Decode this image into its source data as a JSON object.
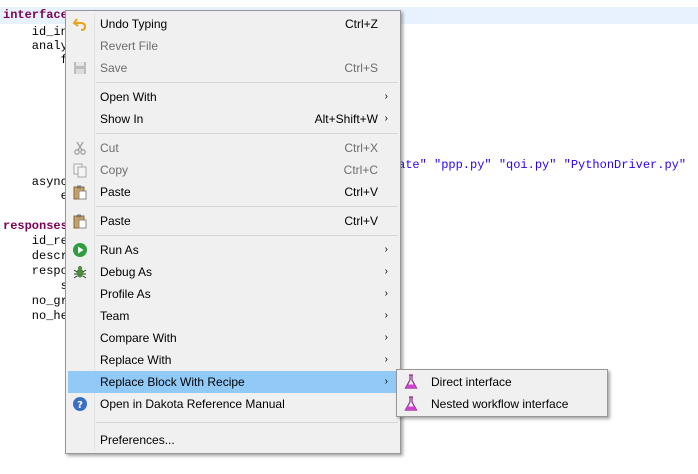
{
  "editor": {
    "lines": [
      {
        "text": "interface",
        "cls": "kw"
      },
      {
        "text": "    id_in",
        "cls": ""
      },
      {
        "text": "    analy",
        "cls": ""
      },
      {
        "text": "        f",
        "cls": ""
      },
      {
        "text": "ate\" \"ppp.py\" \"qoi.py\" \"PythonDriver.py\"",
        "cls": "str"
      },
      {
        "text": "    async",
        "cls": ""
      },
      {
        "text": "        e",
        "cls": ""
      },
      {
        "text": "responses",
        "cls": "kw"
      },
      {
        "text": "    id_re",
        "cls": ""
      },
      {
        "text": "    descr",
        "cls": ""
      },
      {
        "text": "    respo",
        "cls": ""
      },
      {
        "text": "        s",
        "cls": ""
      },
      {
        "text": "    no_gr",
        "cls": ""
      },
      {
        "text": "    no_he",
        "cls": ""
      }
    ]
  },
  "menu": {
    "undo_typing": {
      "label": "Undo Typing",
      "shortcut": "Ctrl+Z",
      "icon": "undo-arrow-icon"
    },
    "revert_file": {
      "label": "Revert File"
    },
    "save": {
      "label": "Save",
      "shortcut": "Ctrl+S",
      "icon": "save-disk-icon"
    },
    "open_with": {
      "label": "Open With"
    },
    "show_in": {
      "label": "Show In",
      "shortcut": "Alt+Shift+W"
    },
    "cut": {
      "label": "Cut",
      "shortcut": "Ctrl+X",
      "icon": "scissors-icon"
    },
    "copy": {
      "label": "Copy",
      "shortcut": "Ctrl+C",
      "icon": "copy-icon"
    },
    "paste": {
      "label": "Paste",
      "shortcut": "Ctrl+V",
      "icon": "clipboard-icon"
    },
    "paste2": {
      "label": "Paste",
      "shortcut": "Ctrl+V",
      "icon": "clipboard-icon"
    },
    "run_as": {
      "label": "Run As",
      "icon": "run-icon"
    },
    "debug_as": {
      "label": "Debug As",
      "icon": "bug-icon"
    },
    "profile_as": {
      "label": "Profile As"
    },
    "team": {
      "label": "Team"
    },
    "compare_with": {
      "label": "Compare With"
    },
    "replace_with": {
      "label": "Replace With"
    },
    "replace_block": {
      "label": "Replace Block With Recipe"
    },
    "open_reference": {
      "label": "Open in Dakota Reference Manual",
      "icon": "help-icon"
    },
    "preferences": {
      "label": "Preferences..."
    }
  },
  "submenu": {
    "direct": {
      "label": "Direct interface",
      "icon": "flask-icon"
    },
    "nested": {
      "label": "Nested workflow interface",
      "icon": "flask-icon"
    }
  },
  "colors": {
    "highlight": "#91c9f7",
    "menu_bg": "#f0f0f0",
    "keyword": "#7f0055",
    "string": "#2a00ff"
  }
}
